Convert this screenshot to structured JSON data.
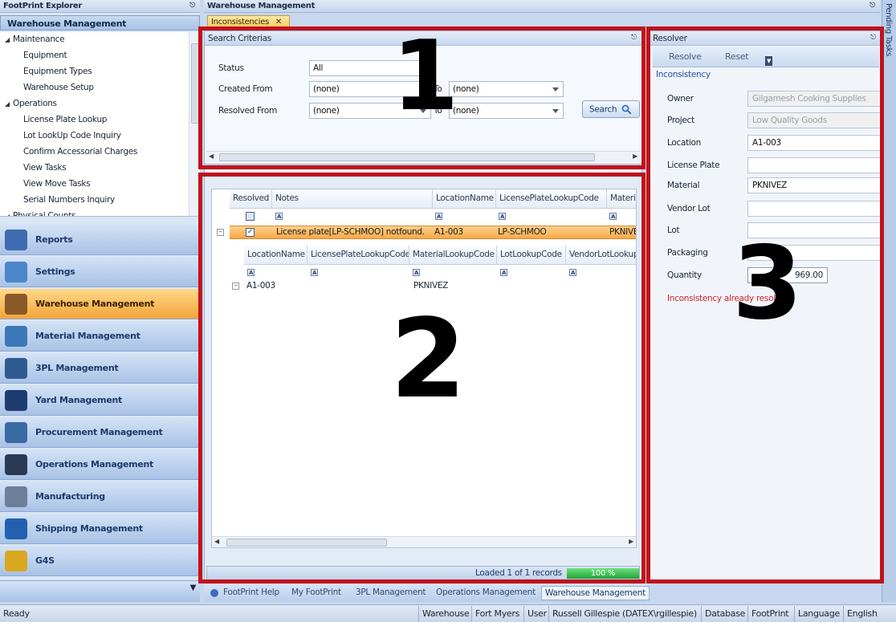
{
  "explorer": {
    "title": "FootPrint Explorer",
    "section_title": "Warehouse Management",
    "tree": [
      {
        "label": "Maintenance",
        "group": true
      },
      {
        "label": "Equipment"
      },
      {
        "label": "Equipment Types"
      },
      {
        "label": "Warehouse Setup"
      },
      {
        "label": "Operations",
        "group": true
      },
      {
        "label": "License Plate Lookup"
      },
      {
        "label": "Lot LookUp Code Inquiry"
      },
      {
        "label": "Confirm Accessorial Charges"
      },
      {
        "label": "View Tasks"
      },
      {
        "label": "View Move Tasks"
      },
      {
        "label": "Serial Numbers Inquiry"
      },
      {
        "label": "Physical Counts",
        "group": true
      }
    ],
    "nav": [
      {
        "label": "Reports",
        "color": "#3f6bb0"
      },
      {
        "label": "Settings",
        "color": "#4a86c8"
      },
      {
        "label": "Warehouse Management",
        "color": "#8a5a2a",
        "active": true
      },
      {
        "label": "Material Management",
        "color": "#3c78b8"
      },
      {
        "label": "3PL Management",
        "color": "#2e5a90"
      },
      {
        "label": "Yard Management",
        "color": "#1e3c70"
      },
      {
        "label": "Procurement Management",
        "color": "#3a6aa4"
      },
      {
        "label": "Operations Management",
        "color": "#2a3a54"
      },
      {
        "label": "Manufacturing",
        "color": "#6b7f9a"
      },
      {
        "label": "Shipping Management",
        "color": "#2460b0"
      },
      {
        "label": "G4S",
        "color": "#d8a820"
      }
    ]
  },
  "main": {
    "title": "Warehouse Management",
    "doc_tab": "Inconsistencies",
    "pending_tasks": "Pending Tasks"
  },
  "search": {
    "title": "Search Criterias",
    "status_label": "Status",
    "status_value": "All",
    "created_from_label": "Created From",
    "created_from_value": "(none)",
    "created_to_label": "To",
    "created_to_value": "(none)",
    "resolved_from_label": "Resolved From",
    "resolved_from_value": "(none)",
    "resolved_to_label": "To",
    "resolved_to_value": "(none)",
    "search_button": "Search"
  },
  "grid": {
    "columns": [
      "Resolved",
      "Notes",
      "LocationName",
      "LicensePlateLookupCode",
      "Materia"
    ],
    "row": {
      "resolved": "✓",
      "notes": "License plate[LP-SCHMOO] notfound.",
      "location": "A1-003",
      "license_plate": "LP-SCHMOO",
      "material": "PKNIVE"
    },
    "detail_columns": [
      "LocationName",
      "LicensePlateLookupCode",
      "MaterialLookupCode",
      "LotLookupCode",
      "VendorLotLookupC"
    ],
    "detail_row": {
      "location": "A1-003",
      "material": "PKNIVEZ"
    },
    "filter_glyph": "A",
    "status_text": "Loaded 1 of 1 records",
    "progress": "100 %"
  },
  "resolver": {
    "title": "Resolver",
    "resolve_button": "Resolve",
    "reset_button": "Reset",
    "group": "Inconsistency",
    "fields": [
      {
        "label": "Owner",
        "value": "Gilgamesh Cooking Supplies",
        "readonly": true
      },
      {
        "label": "Project",
        "value": "Low Quality Goods",
        "readonly": true
      },
      {
        "label": "Location",
        "value": "A1-003",
        "readonly": false
      },
      {
        "label": "License Plate",
        "value": "",
        "readonly": false
      },
      {
        "label": "Material",
        "value": "PKNIVEZ",
        "readonly": false
      },
      {
        "label": "Vendor Lot",
        "value": "",
        "readonly": false
      },
      {
        "label": "Lot",
        "value": "",
        "readonly": false
      },
      {
        "label": "Packaging",
        "value": "",
        "readonly": false
      }
    ],
    "quantity_label": "Quantity",
    "quantity_value": "969.00",
    "message": "Inconsistency already resolved."
  },
  "bottom_tabs": [
    "FootPrint Help",
    "My FootPrint",
    "3PL Management",
    "Operations Management",
    "Warehouse Management"
  ],
  "status_bar": {
    "ready": "Ready",
    "warehouse_label": "Warehouse",
    "warehouse_value": "Fort Myers",
    "user_label": "User",
    "user_value": "Russell Gillespie (DATEX\\rgillespie)",
    "database_label": "Database",
    "database_value": "FootPrint",
    "language_label": "Language",
    "language_value": "English"
  },
  "annotations": {
    "one": "1",
    "two": "2",
    "three": "3",
    "color": "#c1121c"
  }
}
